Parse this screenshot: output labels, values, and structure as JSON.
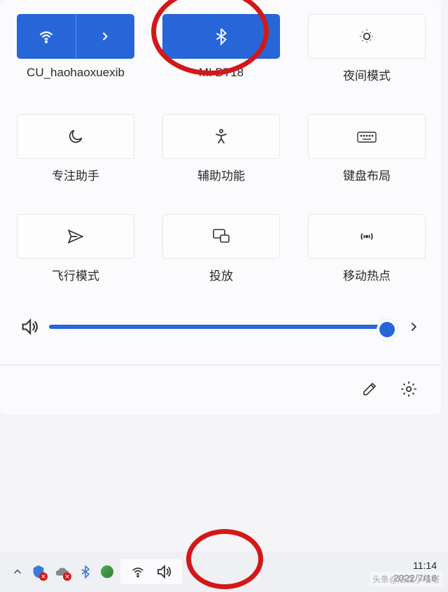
{
  "tiles": [
    {
      "label": "CU_haohaoxuexib",
      "active": true,
      "icon": "wifi"
    },
    {
      "label": "MI BT18",
      "active": true,
      "icon": "bluetooth"
    },
    {
      "label": "夜间模式",
      "active": false,
      "icon": "brightness"
    },
    {
      "label": "专注助手",
      "active": false,
      "icon": "moon"
    },
    {
      "label": "辅助功能",
      "active": false,
      "icon": "accessibility"
    },
    {
      "label": "键盘布局",
      "active": false,
      "icon": "keyboard"
    },
    {
      "label": "飞行模式",
      "active": false,
      "icon": "airplane"
    },
    {
      "label": "投放",
      "active": false,
      "icon": "cast"
    },
    {
      "label": "移动热点",
      "active": false,
      "icon": "hotspot"
    }
  ],
  "volume": {
    "level": 100
  },
  "clock": {
    "time": "11:14",
    "date": "2022/7/16"
  },
  "watermark": "头条@陋西小嗒嗒"
}
